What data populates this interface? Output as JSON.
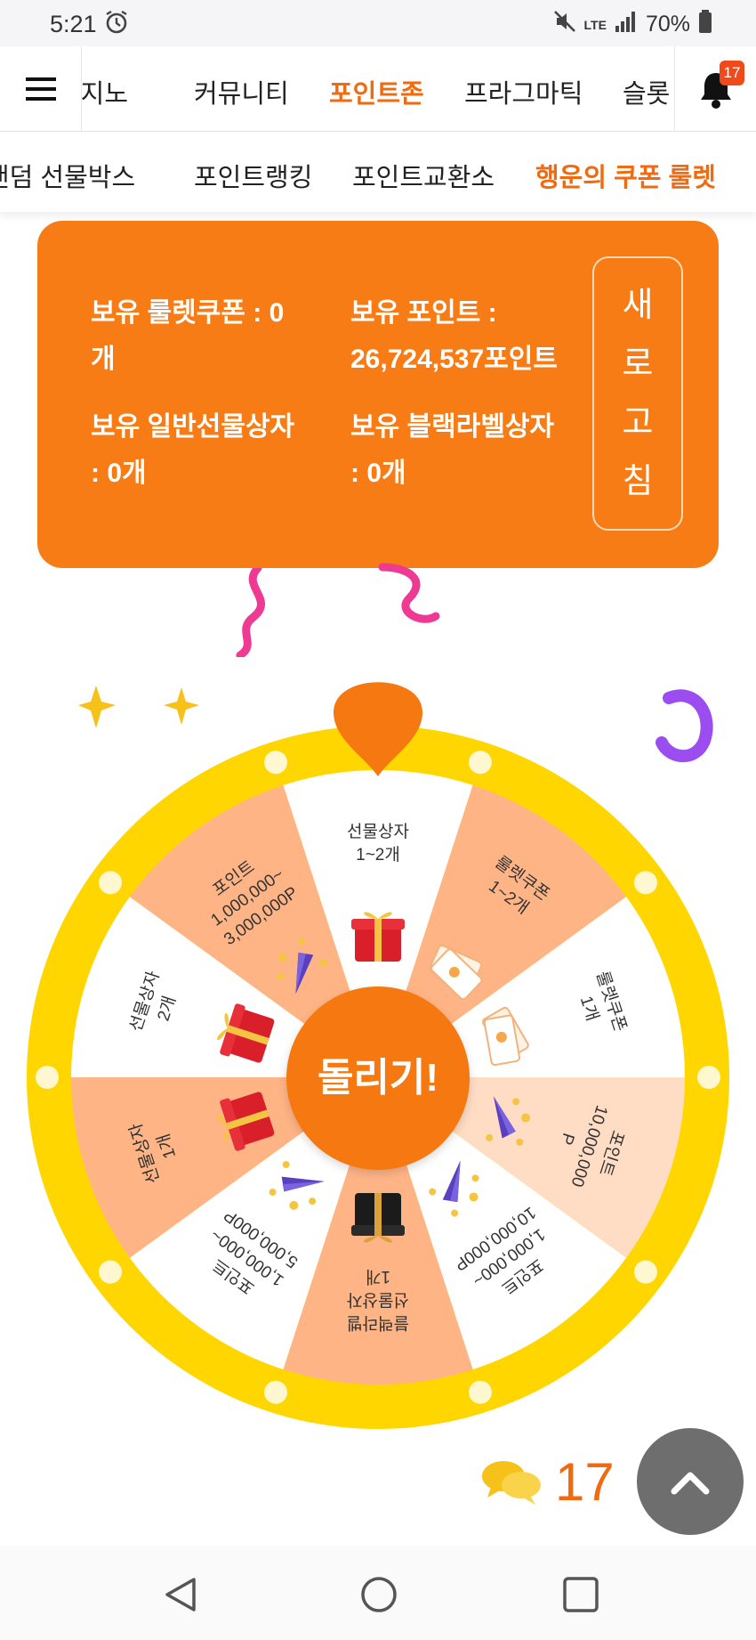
{
  "status_bar": {
    "time": "5:21",
    "network": "LTE",
    "battery": "70%"
  },
  "top_nav": {
    "items": [
      {
        "label": "카지노",
        "active": false
      },
      {
        "label": "커뮤니티",
        "active": false
      },
      {
        "label": "포인트존",
        "active": true
      },
      {
        "label": "프라그마틱",
        "active": false
      },
      {
        "label": "슬롯",
        "active": false
      }
    ],
    "notification_count": "17"
  },
  "sub_nav": {
    "items": [
      {
        "label": "랜덤 선물박스",
        "active": false
      },
      {
        "label": "포인트랭킹",
        "active": false
      },
      {
        "label": "포인트교환소",
        "active": false
      },
      {
        "label": "행운의 쿠폰 룰렛",
        "active": true
      }
    ]
  },
  "info_panel": {
    "roulette_coupons": "보유 룰렛쿠폰 : 0\n개",
    "points": "보유 포인트 :\n26,724,537포인트",
    "normal_gift_box": "보유 일반선물상자\n: 0개",
    "black_label_box": "보유 블랙라벨상자\n: 0개",
    "refresh_chars": [
      "새",
      "로",
      "고",
      "침"
    ]
  },
  "roulette": {
    "spin_label": "돌리기!",
    "segments": [
      {
        "label": "선물상자\n1~2개",
        "color": "#ffffff",
        "icon": "gift-box-icon"
      },
      {
        "label": "룰렛쿠폰\n1~2개",
        "color": "#ffb486",
        "icon": "coupon-icon"
      },
      {
        "label": "룰렛쿠폰\n1개",
        "color": "#ffffff",
        "icon": "coupon-icon"
      },
      {
        "label": "포인트\n10,000,000\nP",
        "color": "#ffdcc4",
        "icon": "party-popper-icon"
      },
      {
        "label": "포인트\n1,000,000~\n10,000,000P",
        "color": "#ffffff",
        "icon": "party-popper-icon"
      },
      {
        "label": "블랙라벨\n선물상자\n1개",
        "color": "#ffb486",
        "icon": "black-gift-box-icon"
      },
      {
        "label": "포인트\n1,000,000~\n5,000,000P",
        "color": "#ffffff",
        "icon": "party-popper-icon"
      },
      {
        "label": "선물상자\n1개",
        "color": "#ffb486",
        "icon": "gift-box-icon"
      },
      {
        "label": "선물상자\n2개",
        "color": "#ffffff",
        "icon": "gift-box-icon"
      },
      {
        "label": "포인트\n1,000,000~\n3,000,000P",
        "color": "#ffb486",
        "icon": "party-popper-icon"
      }
    ]
  },
  "chat": {
    "count": "17"
  },
  "colors": {
    "accent": "#f26a0f",
    "panel": "#f87c16",
    "wheel_rim": "#ffd600"
  }
}
